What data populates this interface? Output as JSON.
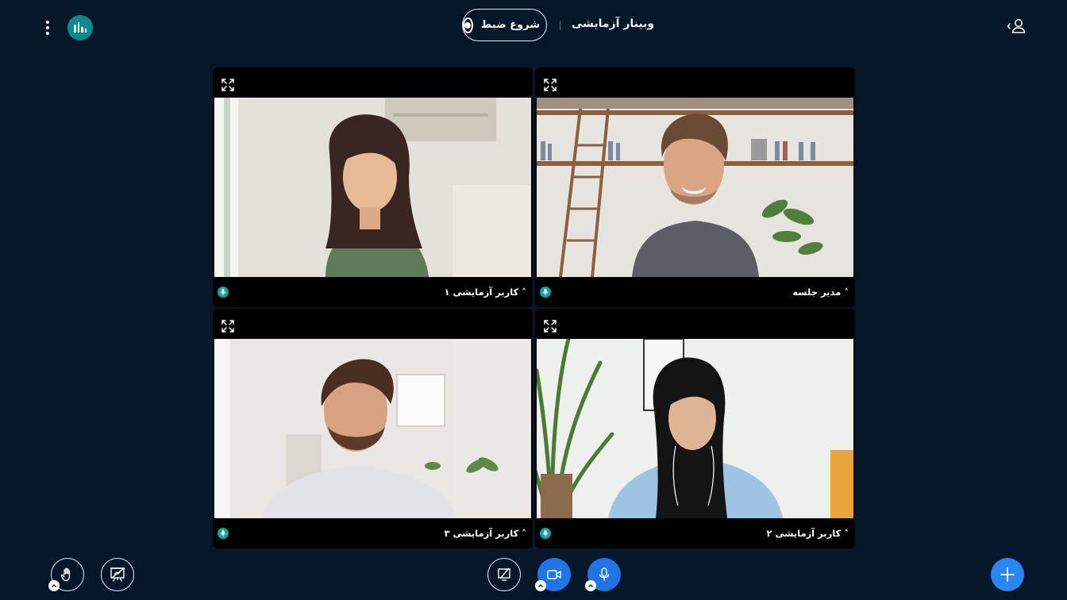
{
  "header": {
    "title": "وبینار آزمایشی",
    "record_label": "شروع ضبط",
    "icons": {
      "menu": "more-vertical-icon",
      "logo": "stats-logo-icon",
      "record": "record-icon",
      "user": "user-icon"
    }
  },
  "tiles": [
    {
      "name": "کاربر آزمایشی ۱",
      "caret": "˄",
      "mic": "mic-active"
    },
    {
      "name": "مدیر جلسه",
      "caret": "˄",
      "mic": "mic-active"
    },
    {
      "name": "کاربر آزمایشی ۳",
      "caret": "˄",
      "mic": "mic-active"
    },
    {
      "name": "کاربر آزمایشی ۲",
      "caret": "˄",
      "mic": "mic-active"
    }
  ],
  "controls": {
    "raise_hand": "hand-icon",
    "presentation": "presentation-icon",
    "screen_share": "screen-share-off-icon",
    "camera": "video-camera-icon",
    "microphone": "microphone-icon",
    "add": "plus-icon"
  },
  "colors": {
    "background": "#06172b",
    "accent_blue": "#1f74e6",
    "mic_teal": "#11a3a0",
    "logo_teal": "#0f8a8c"
  }
}
